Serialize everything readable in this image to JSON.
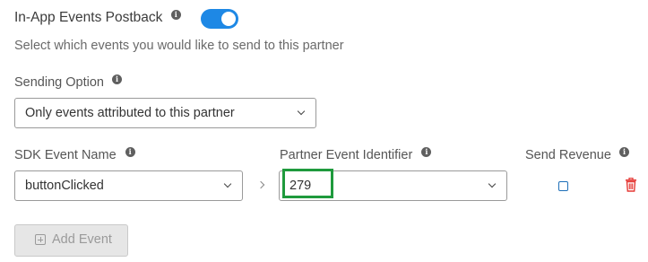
{
  "postback": {
    "title": "In-App Events Postback",
    "info_glyph": "i",
    "enabled": true,
    "description": "Select which events you would like to send to this partner"
  },
  "sending_option": {
    "label": "Sending Option",
    "selected": "Only events attributed to this partner"
  },
  "columns": {
    "sdk_event_name": "SDK Event Name",
    "partner_event_identifier": "Partner Event Identifier",
    "send_revenue": "Send Revenue"
  },
  "event_row": {
    "sdk_event_name": "buttonClicked",
    "partner_event_identifier": "279",
    "send_revenue": false
  },
  "add_event": {
    "label": "Add Event"
  },
  "colors": {
    "toggle_on": "#1e88e5",
    "highlight": "#1f9a3d",
    "delete": "#e53935"
  },
  "icons": [
    "info-icon",
    "chevron-down-icon",
    "chevron-right-icon",
    "trash-icon",
    "plus-square-icon"
  ]
}
